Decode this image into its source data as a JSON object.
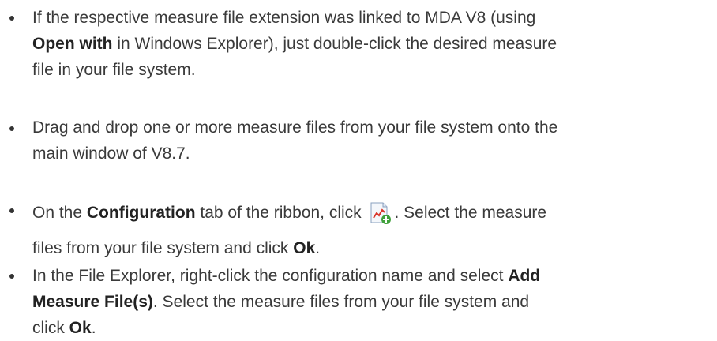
{
  "items": [
    {
      "lines": [
        [
          "If the respective measure file extension was linked to MDA V8 (using"
        ],
        [
          {
            "b": "Open with"
          },
          " in Windows Explorer), just double-click the desired measure"
        ],
        [
          "file in your file system."
        ]
      ]
    },
    {
      "lines": [
        [
          "Drag and drop one or more measure files from your file system onto the"
        ],
        [
          "main window of V8.7."
        ]
      ]
    },
    {
      "lines": [
        [
          "On the ",
          {
            "b": "Configuration"
          },
          " tab of the ribbon, click ",
          {
            "icon": "add-measure-file-icon"
          },
          ". Select the measure"
        ],
        [
          "files from your file system and click ",
          {
            "b": "Ok"
          },
          "."
        ]
      ]
    },
    {
      "lines": [
        [
          "In the File Explorer, right-click the configuration name and select ",
          {
            "b": "Add"
          }
        ],
        [
          {
            "b": "Measure File(s)"
          },
          ". Select the measure files from your file system and"
        ],
        [
          "click ",
          {
            "b": "Ok"
          },
          "."
        ]
      ]
    }
  ],
  "icons": {
    "add_measure_file": "add-measure-file-icon"
  }
}
